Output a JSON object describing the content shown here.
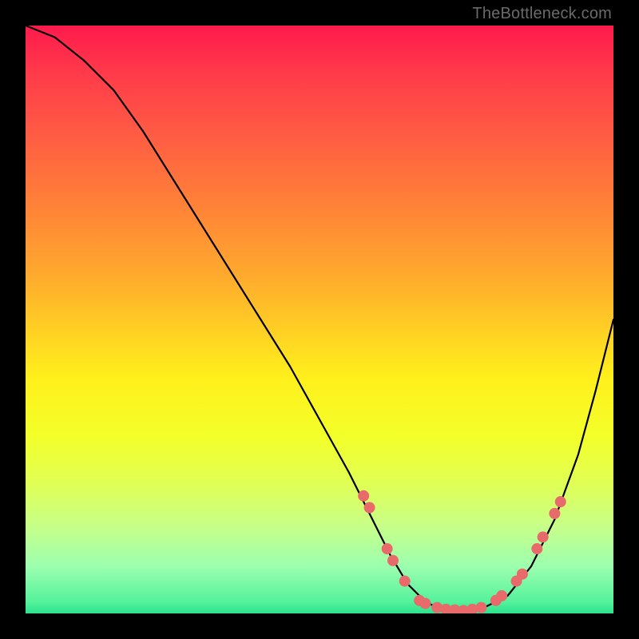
{
  "watermark": "TheBottleneck.com",
  "chart_data": {
    "type": "line",
    "title": "",
    "xlabel": "",
    "ylabel": "",
    "xlim": [
      0,
      100
    ],
    "ylim": [
      0,
      100
    ],
    "series": [
      {
        "name": "curve",
        "x": [
          0,
          5,
          10,
          15,
          20,
          25,
          30,
          35,
          40,
          45,
          50,
          55,
          60,
          62,
          65,
          68,
          70,
          72,
          75,
          78,
          82,
          86,
          90,
          94,
          97,
          100
        ],
        "values": [
          100,
          98,
          94,
          89,
          82,
          74,
          66,
          58,
          50,
          42,
          33,
          24,
          14,
          10,
          5,
          2,
          1,
          0.5,
          0.5,
          1,
          3,
          8,
          16,
          27,
          38,
          50
        ]
      }
    ],
    "markers": [
      {
        "x": 57.5,
        "y": 20
      },
      {
        "x": 58.5,
        "y": 18
      },
      {
        "x": 61.5,
        "y": 11
      },
      {
        "x": 62.5,
        "y": 9
      },
      {
        "x": 64.5,
        "y": 5.5
      },
      {
        "x": 67.0,
        "y": 2.2
      },
      {
        "x": 68.0,
        "y": 1.7
      },
      {
        "x": 70.0,
        "y": 1.0
      },
      {
        "x": 71.5,
        "y": 0.7
      },
      {
        "x": 73.0,
        "y": 0.6
      },
      {
        "x": 74.5,
        "y": 0.5
      },
      {
        "x": 76.0,
        "y": 0.7
      },
      {
        "x": 77.5,
        "y": 1.0
      },
      {
        "x": 80.0,
        "y": 2.2
      },
      {
        "x": 81.0,
        "y": 3.0
      },
      {
        "x": 83.5,
        "y": 5.5
      },
      {
        "x": 84.5,
        "y": 6.7
      },
      {
        "x": 87.0,
        "y": 11
      },
      {
        "x": 88.0,
        "y": 13
      },
      {
        "x": 90.0,
        "y": 17
      },
      {
        "x": 91.0,
        "y": 19
      }
    ],
    "marker_color": "#e86a6a",
    "marker_radius_px": 7
  }
}
